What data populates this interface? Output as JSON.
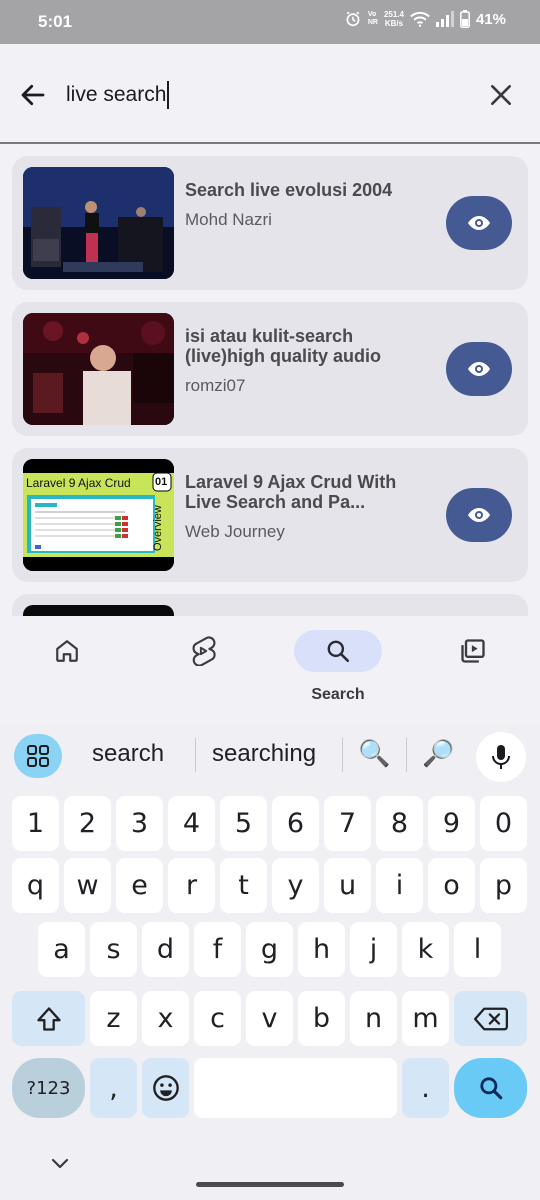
{
  "status_bar": {
    "time": "5:01",
    "vo_top": "Vo",
    "vo_bottom": "NR",
    "net_speed_value": "251.4",
    "net_speed_unit": "KB/s",
    "battery": "41%"
  },
  "search": {
    "query": "live search"
  },
  "results": [
    {
      "title": "Search live evolusi 2004",
      "channel": "Mohd Nazri"
    },
    {
      "title": "isi atau kulit-search (live)high quality audio",
      "channel": "romzi07"
    },
    {
      "title": "Laravel 9 Ajax Crud With Live Search and Pa...",
      "channel": "Web Journey",
      "thumb_title": "Laravel 9 Ajax Crud",
      "thumb_badge": "01",
      "thumb_side": "Overview"
    }
  ],
  "bottom_nav": {
    "items": [
      {
        "name": "home",
        "label": ""
      },
      {
        "name": "shorts",
        "label": ""
      },
      {
        "name": "search",
        "label": "Search"
      },
      {
        "name": "library",
        "label": ""
      }
    ],
    "active": "search"
  },
  "keyboard": {
    "suggestions": [
      "search",
      "searching"
    ],
    "suggestion_emojis": [
      "🔍",
      "🔎"
    ],
    "row_numbers": [
      "1",
      "2",
      "3",
      "4",
      "5",
      "6",
      "7",
      "8",
      "9",
      "0"
    ],
    "row_1": [
      "q",
      "w",
      "e",
      "r",
      "t",
      "y",
      "u",
      "i",
      "o",
      "p"
    ],
    "row_2": [
      "a",
      "s",
      "d",
      "f",
      "g",
      "h",
      "j",
      "k",
      "l"
    ],
    "row_3": [
      "z",
      "x",
      "c",
      "v",
      "b",
      "n",
      "m"
    ],
    "symbols_key": "?123",
    "comma_key": ",",
    "period_key": "."
  },
  "colors": {
    "watch_button": "#455a93",
    "nav_active_pill": "#d9e1fa",
    "keyboard_action": "#69caf5"
  }
}
